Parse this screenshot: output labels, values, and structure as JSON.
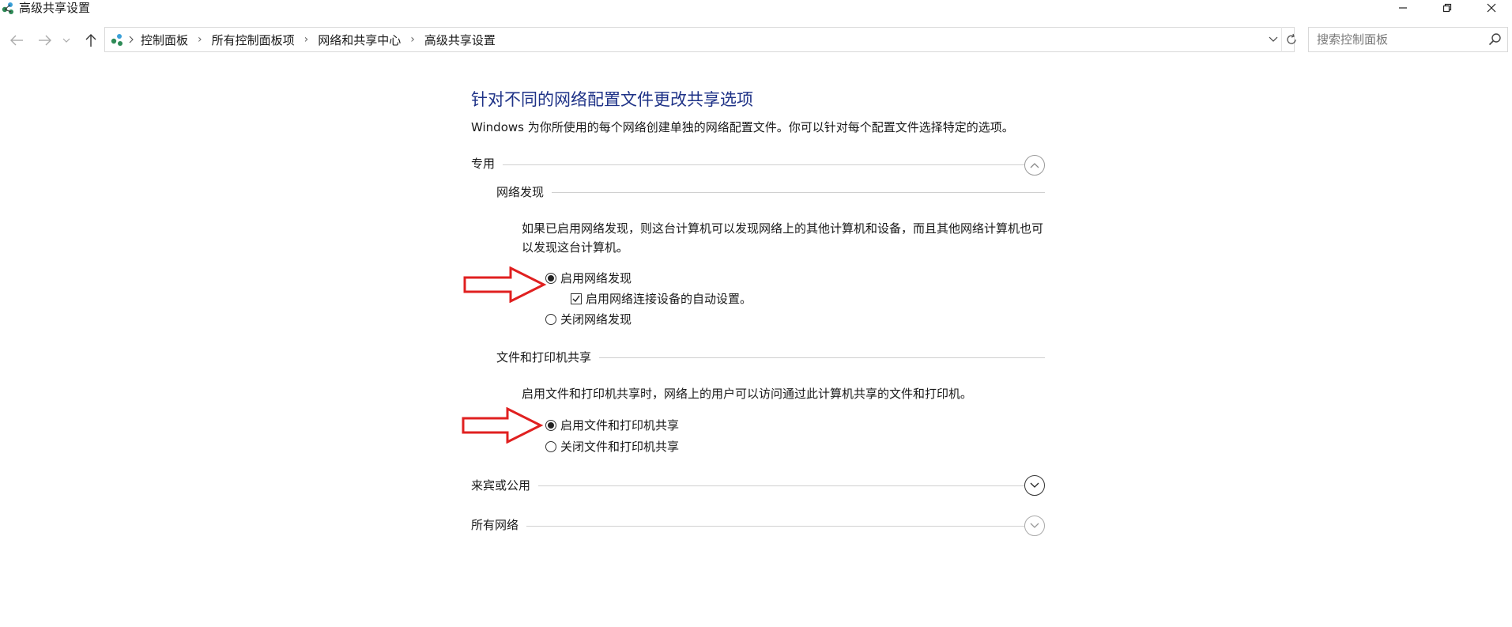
{
  "window": {
    "title": "高级共享设置",
    "app_icon": "network-sharing-icon",
    "controls": [
      "minimize-icon",
      "restore-icon",
      "close-icon"
    ]
  },
  "nav": {
    "back_icon": "back-arrow-icon",
    "forward_icon": "forward-arrow-icon",
    "recent_icon": "chevron-down-icon",
    "up_icon": "up-arrow-icon",
    "breadcrumbs": [
      "控制面板",
      "所有控制面板项",
      "网络和共享中心",
      "高级共享设置"
    ],
    "search_placeholder": "搜索控制面板"
  },
  "content": {
    "heading": "针对不同的网络配置文件更改共享选项",
    "intro": "Windows 为你所使用的每个网络创建单独的网络配置文件。你可以针对每个配置文件选择特定的选项。",
    "sections": {
      "private": {
        "label": "专用",
        "expanded": true,
        "network_discovery": {
          "label": "网络发现",
          "description": "如果已启用网络发现，则这台计算机可以发现网络上的其他计算机和设备，而且其他网络计算机也可以发现这台计算机。",
          "on_label": "启用网络发现",
          "auto_setup_label": "启用网络连接设备的自动设置。",
          "off_label": "关闭网络发现",
          "selected": "on",
          "auto_setup_checked": true
        },
        "file_printer_sharing": {
          "label": "文件和打印机共享",
          "description": "启用文件和打印机共享时，网络上的用户可以访问通过此计算机共享的文件和打印机。",
          "on_label": "启用文件和打印机共享",
          "off_label": "关闭文件和打印机共享",
          "selected": "on"
        }
      },
      "guest_public": {
        "label": "来宾或公用",
        "expanded": false
      },
      "all_networks": {
        "label": "所有网络",
        "expanded": false
      }
    }
  },
  "annotations": {
    "arrow_color": "#e02020"
  },
  "colors": {
    "heading": "#1e3287"
  }
}
